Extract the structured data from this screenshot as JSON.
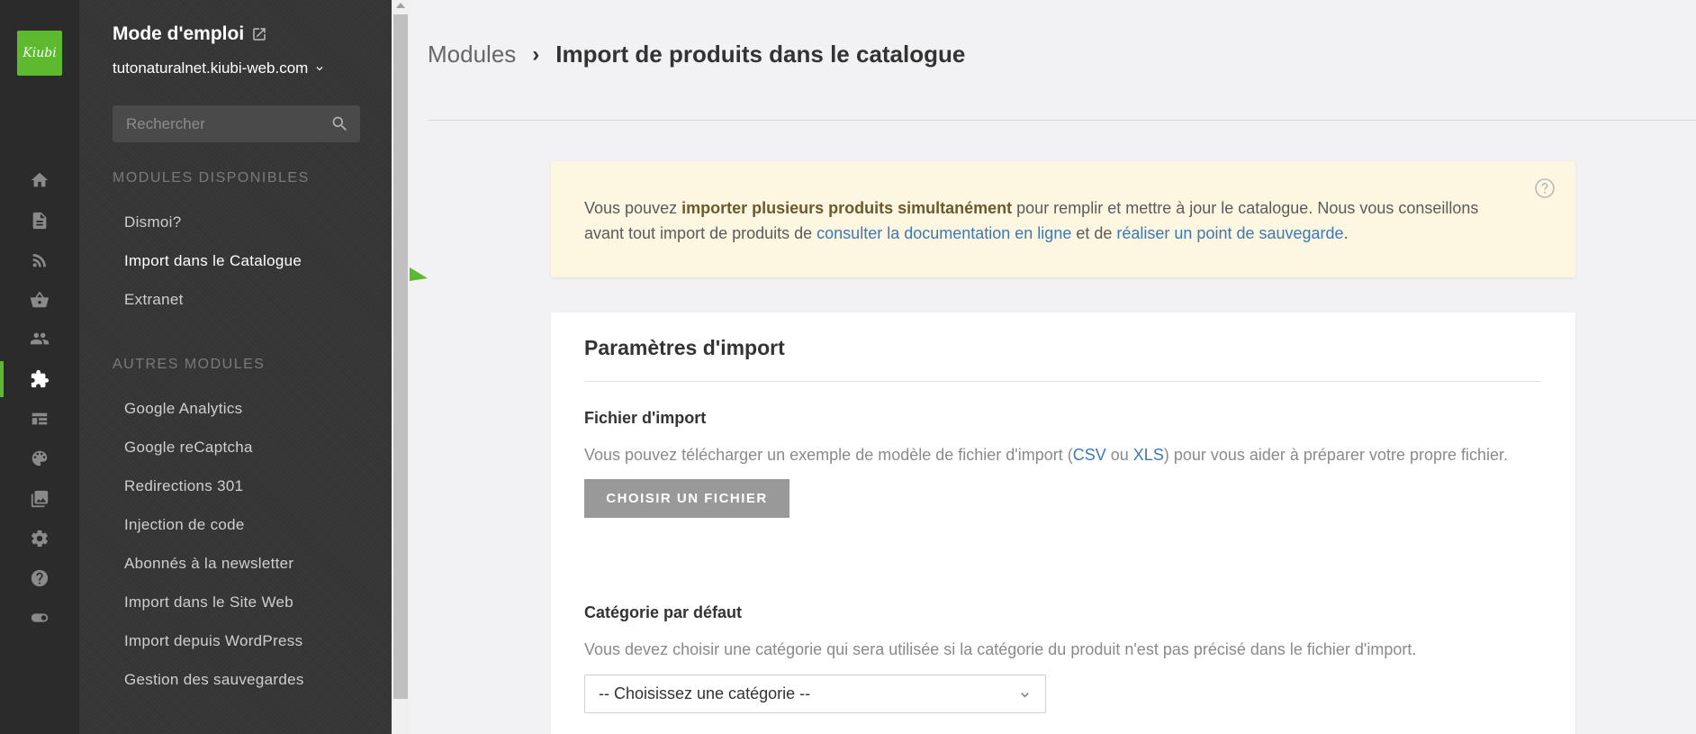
{
  "app": {
    "logo_text": "Kiubi",
    "accent_color": "#5dba2f"
  },
  "rail": [
    {
      "icon": "home-icon"
    },
    {
      "icon": "page-icon"
    },
    {
      "icon": "rss-icon"
    },
    {
      "icon": "basket-icon"
    },
    {
      "icon": "users-icon"
    },
    {
      "icon": "puzzle-icon",
      "active": true
    },
    {
      "icon": "layout-icon"
    },
    {
      "icon": "palette-icon"
    },
    {
      "icon": "image-icon"
    },
    {
      "icon": "gear-icon"
    },
    {
      "icon": "help-icon"
    },
    {
      "icon": "toggle-icon"
    }
  ],
  "sidebar": {
    "title": "Mode d'emploi",
    "domain": "tutonaturalnet.kiubi-web.com",
    "search_placeholder": "Rechercher",
    "available_heading": "MODULES DISPONIBLES",
    "available": [
      {
        "label": "Dismoi?"
      },
      {
        "label": "Import dans le Catalogue",
        "active": true
      },
      {
        "label": "Extranet"
      }
    ],
    "other_heading": "AUTRES MODULES",
    "other": [
      {
        "label": "Google Analytics"
      },
      {
        "label": "Google reCaptcha"
      },
      {
        "label": "Redirections 301"
      },
      {
        "label": "Injection de code"
      },
      {
        "label": "Abonnés à la newsletter"
      },
      {
        "label": "Import dans le Site Web"
      },
      {
        "label": "Import depuis WordPress"
      },
      {
        "label": "Gestion des sauvegardes"
      }
    ]
  },
  "breadcrumb": {
    "parent": "Modules",
    "separator": "›",
    "current": "Import de produits dans le catalogue"
  },
  "notice": {
    "t1": "Vous pouvez ",
    "bold": "importer plusieurs produits simultanément",
    "t2": " pour remplir et mettre à jour le catalogue. Nous vous conseillons avant tout import de produits de ",
    "link1": "consulter la documentation en ligne",
    "t3": " et de ",
    "link2": "réaliser un point de sauvegarde",
    "t4": "."
  },
  "panel": {
    "title": "Paramètres d'import",
    "file": {
      "label": "Fichier d'import",
      "help_pre": "Vous pouvez télécharger un exemple de modèle de fichier d'import (",
      "csv": "CSV",
      "or": " ou ",
      "xls": "XLS",
      "help_post": ") pour vous aider à préparer votre propre fichier.",
      "button": "CHOISIR UN FICHIER"
    },
    "category": {
      "label": "Catégorie par défaut",
      "help": "Vous devez choisir une catégorie qui sera utilisée si la catégorie du produit n'est pas précisé dans le fichier d'import.",
      "selected": "-- Choisissez une catégorie --"
    }
  }
}
